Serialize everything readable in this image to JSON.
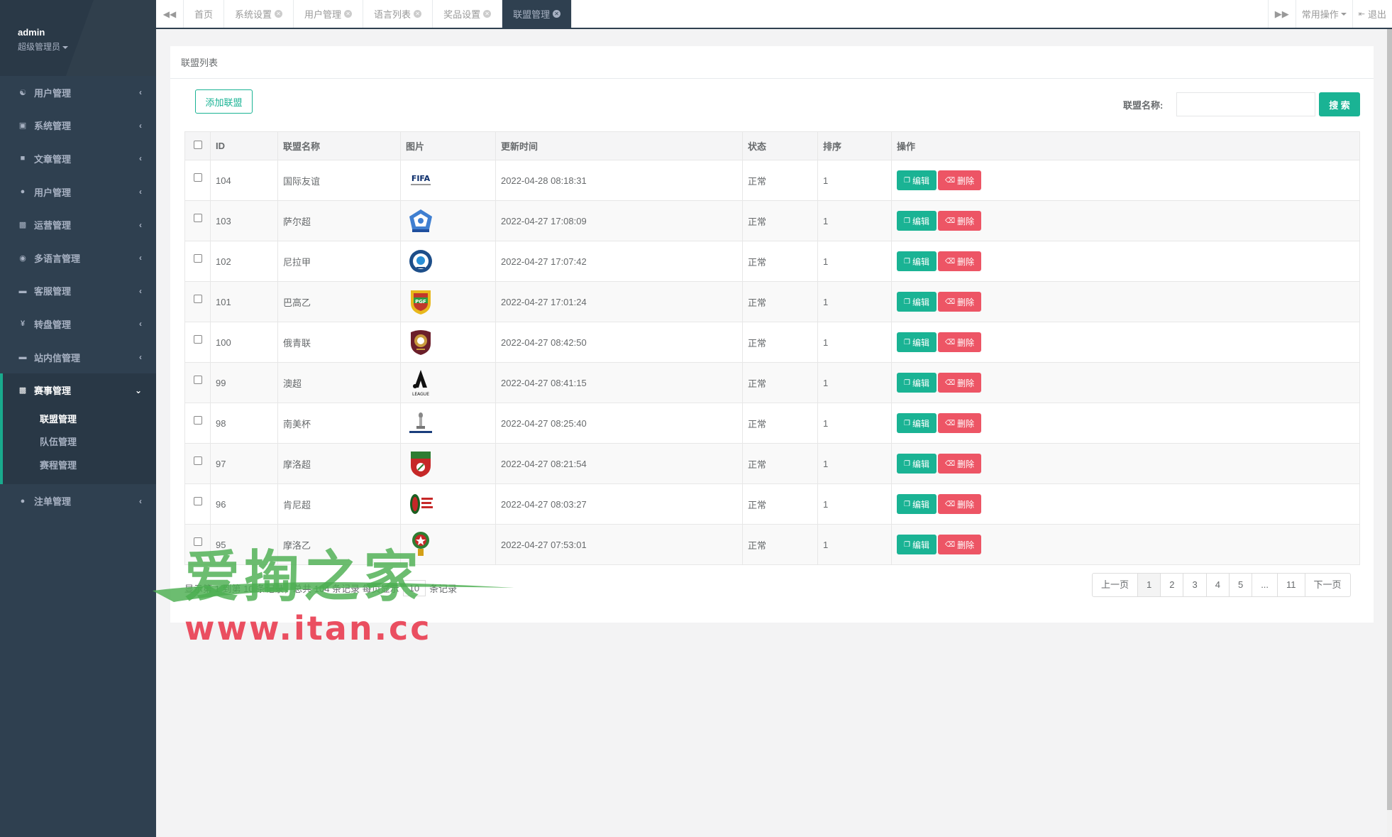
{
  "profile": {
    "username": "admin",
    "role": "超级管理员"
  },
  "sidebar": {
    "items": [
      {
        "label": "用户管理",
        "icon": "users-icon"
      },
      {
        "label": "系统管理",
        "icon": "desktop-icon"
      },
      {
        "label": "文章管理",
        "icon": "book-icon"
      },
      {
        "label": "用户管理",
        "icon": "user-icon"
      },
      {
        "label": "运营管理",
        "icon": "bar-chart-icon"
      },
      {
        "label": "多语言管理",
        "icon": "globe-icon"
      },
      {
        "label": "客服管理",
        "icon": "comment-icon"
      },
      {
        "label": "转盘管理",
        "icon": "yen-icon"
      },
      {
        "label": "站内信管理",
        "icon": "comment-icon"
      }
    ],
    "active_group": {
      "label": "赛事管理",
      "icon": "bar-chart-icon",
      "children": [
        "联盟管理",
        "队伍管理",
        "赛程管理"
      ],
      "active_child": "联盟管理"
    },
    "after_items": [
      {
        "label": "注单管理",
        "icon": "user-icon"
      }
    ]
  },
  "tabs": [
    {
      "label": "首页",
      "closable": false
    },
    {
      "label": "系统设置",
      "closable": true
    },
    {
      "label": "用户管理",
      "closable": true
    },
    {
      "label": "语言列表",
      "closable": true
    },
    {
      "label": "奖品设置",
      "closable": true
    },
    {
      "label": "联盟管理",
      "closable": true,
      "active": true
    }
  ],
  "tabbar": {
    "common_ops": "常用操作",
    "logout": "退出"
  },
  "panel": {
    "title": "联盟列表",
    "add_button": "添加联盟",
    "search_label": "联盟名称:",
    "search_value": "",
    "search_button": "搜 索"
  },
  "table": {
    "headers": [
      "ID",
      "联盟名称",
      "图片",
      "更新时间",
      "状态",
      "排序",
      "操作"
    ],
    "edit_label": "编辑",
    "delete_label": "删除",
    "rows": [
      {
        "id": "104",
        "name": "国际友谊",
        "logo": "fifa",
        "updated": "2022-04-28 08:18:31",
        "status": "正常",
        "sort": "1"
      },
      {
        "id": "103",
        "name": "萨尔超",
        "logo": "salvador",
        "updated": "2022-04-27 17:08:09",
        "status": "正常",
        "sort": "1"
      },
      {
        "id": "102",
        "name": "尼拉甲",
        "logo": "nicaragua",
        "updated": "2022-04-27 17:07:42",
        "status": "正常",
        "sort": "1"
      },
      {
        "id": "101",
        "name": "巴高乙",
        "logo": "paraguay",
        "updated": "2022-04-27 17:01:24",
        "status": "正常",
        "sort": "1"
      },
      {
        "id": "100",
        "name": "俄青联",
        "logo": "russia",
        "updated": "2022-04-27 08:42:50",
        "status": "正常",
        "sort": "1"
      },
      {
        "id": "99",
        "name": "澳超",
        "logo": "aleague",
        "updated": "2022-04-27 08:41:15",
        "status": "正常",
        "sort": "1"
      },
      {
        "id": "98",
        "name": "南美杯",
        "logo": "sudamericana",
        "updated": "2022-04-27 08:25:40",
        "status": "正常",
        "sort": "1"
      },
      {
        "id": "97",
        "name": "摩洛超",
        "logo": "botola",
        "updated": "2022-04-27 08:21:54",
        "status": "正常",
        "sort": "1"
      },
      {
        "id": "96",
        "name": "肯尼超",
        "logo": "kenya",
        "updated": "2022-04-27 08:03:27",
        "status": "正常",
        "sort": "1"
      },
      {
        "id": "95",
        "name": "摩洛乙",
        "logo": "morocco2",
        "updated": "2022-04-27 07:53:01",
        "status": "正常",
        "sort": "1"
      }
    ]
  },
  "footer": {
    "info_prefix": "显示第 1 到第 10 条记录，总共 104 条记录 每页显示",
    "page_size": "10",
    "info_suffix": "条记录"
  },
  "pagination": [
    "上一页",
    "1",
    "2",
    "3",
    "4",
    "5",
    "...",
    "11",
    "下一页"
  ],
  "logo_text": {
    "fifa": "FIFA",
    "paraguay": "PGF",
    "aleague": "LEAGUE"
  },
  "watermark": {
    "cn": "爱掏之家",
    "url": "www.itan.cc"
  },
  "colors": {
    "sidebar": "#2f4050",
    "primary": "#1ab394",
    "danger": "#ed5565"
  }
}
